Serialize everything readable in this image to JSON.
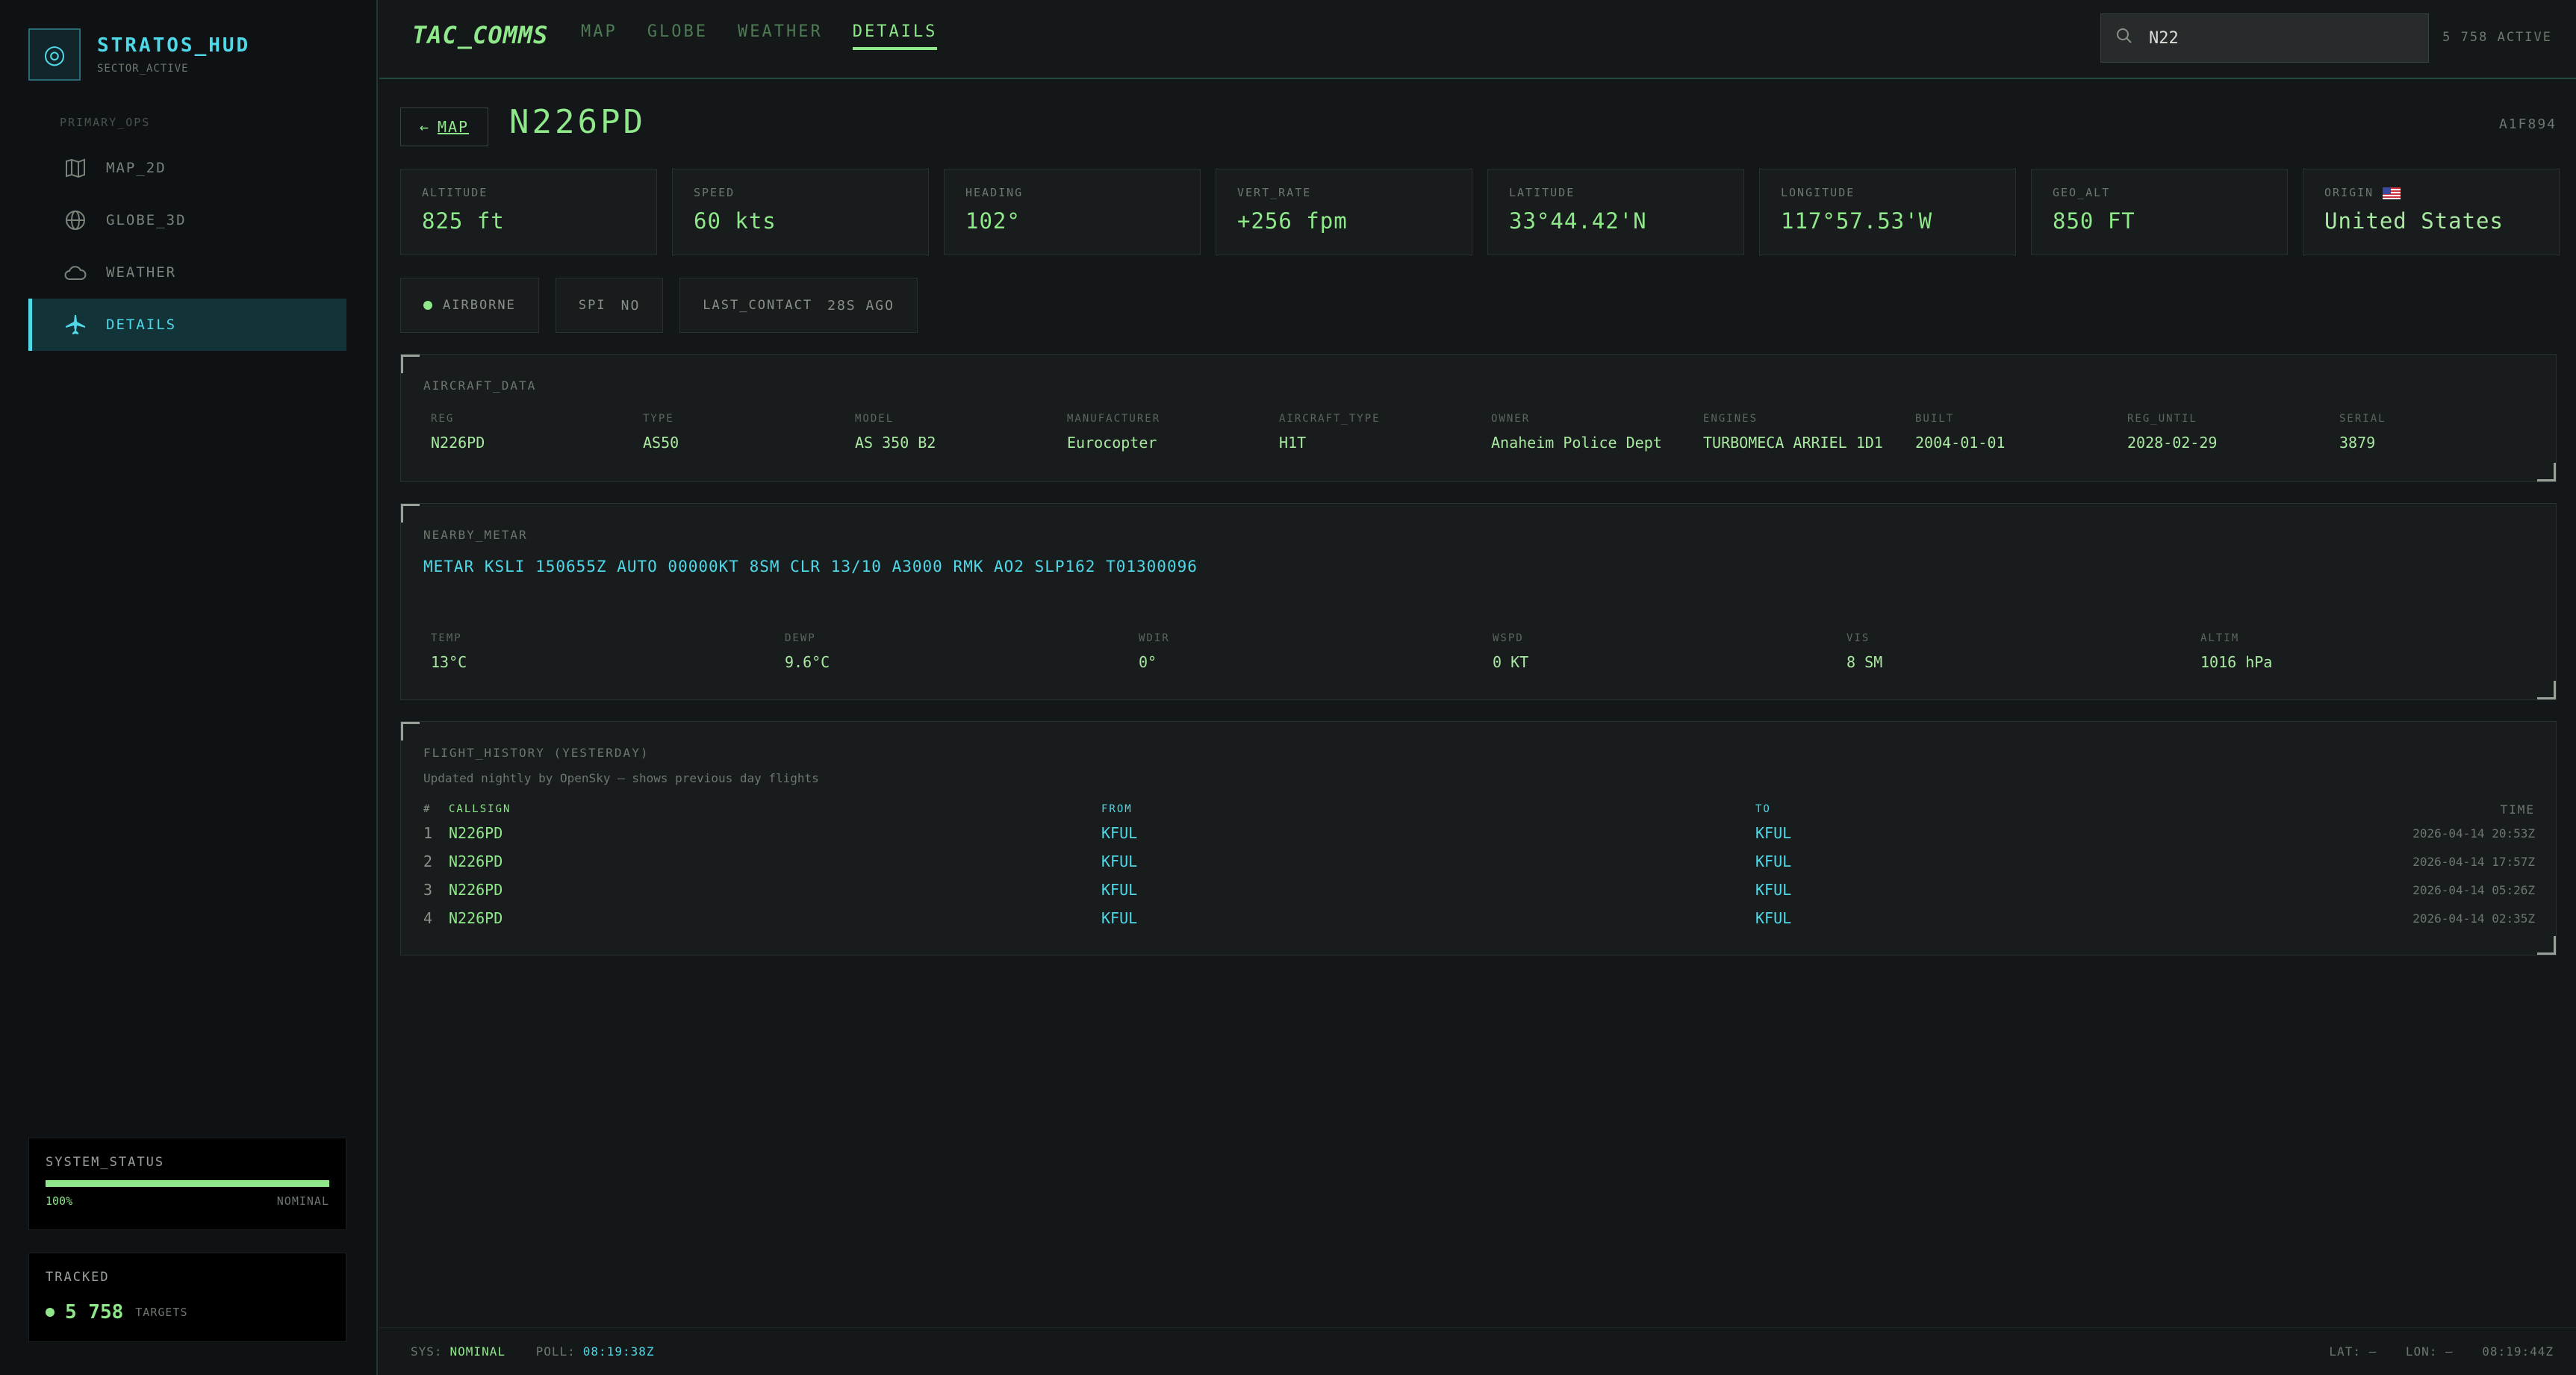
{
  "brand": {
    "title": "STRATOS_HUD",
    "subtitle": "SECTOR_ACTIVE"
  },
  "sidebar": {
    "section": "PRIMARY_OPS",
    "items": [
      {
        "label": "MAP_2D",
        "icon": "map-icon"
      },
      {
        "label": "GLOBE_3D",
        "icon": "globe-icon"
      },
      {
        "label": "WEATHER",
        "icon": "cloud-icon"
      },
      {
        "label": "DETAILS",
        "icon": "airplane-icon",
        "active": true
      }
    ],
    "system_status": {
      "title": "SYSTEM_STATUS",
      "percent": "100%",
      "state": "NOMINAL",
      "fill": 1.0
    },
    "tracked": {
      "title": "TRACKED",
      "count": "5 758",
      "unit": "TARGETS"
    }
  },
  "header": {
    "app_title": "TAC_COMMS",
    "tabs": [
      "MAP",
      "GLOBE",
      "WEATHER",
      "DETAILS"
    ],
    "search_value": "N22",
    "active_count": "5 758 ACTIVE"
  },
  "detail": {
    "back_label": "MAP",
    "callsign": "N226PD",
    "hex": "A1F894",
    "stats": [
      {
        "label": "ALTITUDE",
        "value": "825 ft"
      },
      {
        "label": "SPEED",
        "value": "60 kts"
      },
      {
        "label": "HEADING",
        "value": "102°"
      },
      {
        "label": "VERT_RATE",
        "value": "+256 fpm"
      },
      {
        "label": "LATITUDE",
        "value": "33°44.42'N"
      },
      {
        "label": "LONGITUDE",
        "value": "117°57.53'W"
      },
      {
        "label": "GEO_ALT",
        "value": "850 FT"
      },
      {
        "label": "ORIGIN",
        "value": "United States"
      }
    ],
    "chips": {
      "state": "AIRBORNE",
      "spi_label": "SPI",
      "spi_value": "NO",
      "contact_label": "LAST_CONTACT",
      "contact_value": "28S AGO"
    },
    "aircraft": {
      "title": "AIRCRAFT_DATA",
      "fields": [
        {
          "label": "REG",
          "value": "N226PD"
        },
        {
          "label": "TYPE",
          "value": "AS50"
        },
        {
          "label": "MODEL",
          "value": "AS 350 B2"
        },
        {
          "label": "MANUFACTURER",
          "value": "Eurocopter"
        },
        {
          "label": "AIRCRAFT_TYPE",
          "value": "H1T"
        },
        {
          "label": "OWNER",
          "value": "Anaheim Police Dept"
        },
        {
          "label": "ENGINES",
          "value": "TURBOMECA ARRIEL 1D1"
        },
        {
          "label": "BUILT",
          "value": "2004-01-01"
        },
        {
          "label": "REG_UNTIL",
          "value": "2028-02-29"
        },
        {
          "label": "SERIAL",
          "value": "3879"
        }
      ]
    },
    "metar": {
      "title": "NEARBY_METAR",
      "raw": "METAR KSLI 150655Z AUTO 00000KT 8SM CLR 13/10 A3000 RMK AO2 SLP162 T01300096",
      "fields": [
        {
          "label": "TEMP",
          "value": "13°C"
        },
        {
          "label": "DEWP",
          "value": "9.6°C"
        },
        {
          "label": "WDIR",
          "value": "0°"
        },
        {
          "label": "WSPD",
          "value": "0 KT"
        },
        {
          "label": "VIS",
          "value": "8 SM"
        },
        {
          "label": "ALTIM",
          "value": "1016 hPa"
        }
      ]
    },
    "history": {
      "title": "FLIGHT_HISTORY (YESTERDAY)",
      "note": "Updated nightly by OpenSky — shows previous day flights",
      "headers": [
        "#",
        "CALLSIGN",
        "FROM",
        "TO",
        "TIME"
      ],
      "rows": [
        {
          "idx": "1",
          "callsign": "N226PD",
          "from": "KFUL",
          "to": "KFUL",
          "time": "2026-04-14 20:53Z"
        },
        {
          "idx": "2",
          "callsign": "N226PD",
          "from": "KFUL",
          "to": "KFUL",
          "time": "2026-04-14 17:57Z"
        },
        {
          "idx": "3",
          "callsign": "N226PD",
          "from": "KFUL",
          "to": "KFUL",
          "time": "2026-04-14 05:26Z"
        },
        {
          "idx": "4",
          "callsign": "N226PD",
          "from": "KFUL",
          "to": "KFUL",
          "time": "2026-04-14 02:35Z"
        }
      ]
    }
  },
  "footer": {
    "sys_label": "SYS:",
    "sys_value": "NOMINAL",
    "poll_label": "POLL:",
    "poll_value": "08:19:38Z",
    "lat": "LAT: —",
    "lon": "LON: —",
    "clock": "08:19:44Z"
  }
}
